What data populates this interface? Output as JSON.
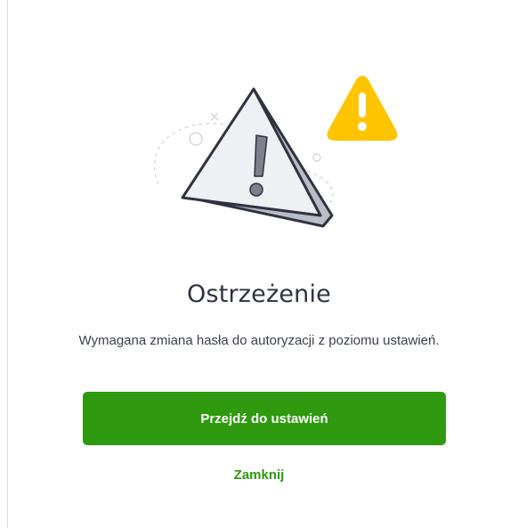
{
  "dialog": {
    "title": "Ostrzeżenie",
    "message": "Wymagana zmiana hasła do autoryzacji z poziomu ustawień.",
    "primary_button_label": "Przejdź do ustawień",
    "close_link_label": "Zamknij"
  },
  "illustration": {
    "main_icon": "warning-triangle-icon",
    "badge_icon": "warning-badge-icon",
    "badge_color": "#ffc400"
  },
  "colors": {
    "accent": "#2f9a0f",
    "title_text": "#2f3340",
    "body_text": "#3b3f4a"
  }
}
